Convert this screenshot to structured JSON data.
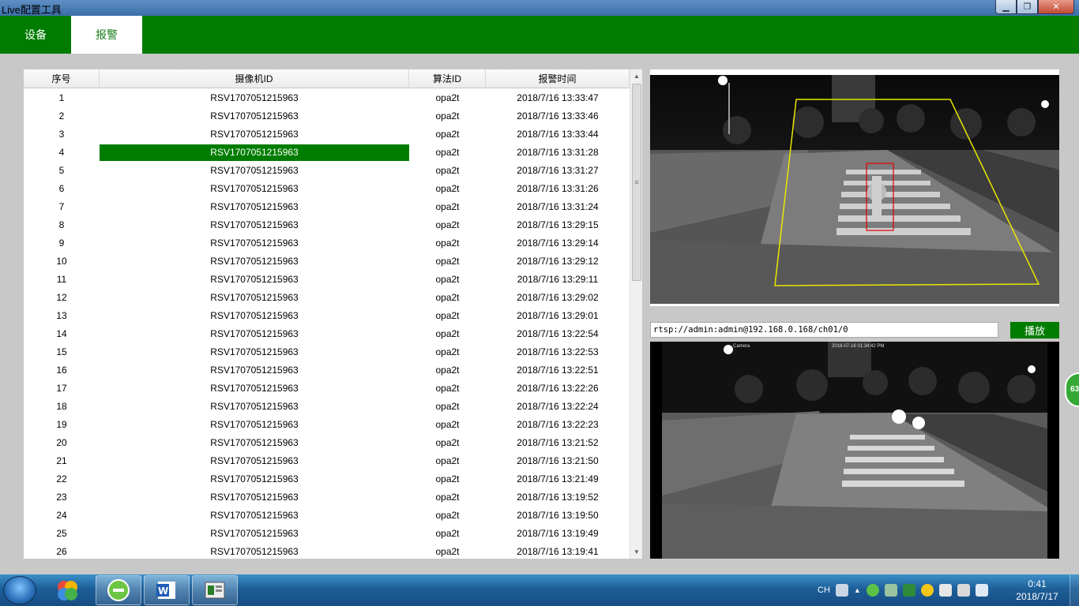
{
  "window": {
    "title": "Live配置工具"
  },
  "menu": {
    "tabs": [
      {
        "label": "设备"
      },
      {
        "label": "报警"
      }
    ],
    "active_tab": "报警",
    "accent": "#007d00"
  },
  "alarms": {
    "columns": [
      "序号",
      "摄像机ID",
      "算法ID",
      "报警时间"
    ],
    "selected_index": 4,
    "rows": [
      [
        "1",
        "RSV1707051215963",
        "opa2t",
        "2018/7/16 13:33:47"
      ],
      [
        "2",
        "RSV1707051215963",
        "opa2t",
        "2018/7/16 13:33:46"
      ],
      [
        "3",
        "RSV1707051215963",
        "opa2t",
        "2018/7/16 13:33:44"
      ],
      [
        "4",
        "RSV1707051215963",
        "opa2t",
        "2018/7/16 13:31:28"
      ],
      [
        "5",
        "RSV1707051215963",
        "opa2t",
        "2018/7/16 13:31:27"
      ],
      [
        "6",
        "RSV1707051215963",
        "opa2t",
        "2018/7/16 13:31:26"
      ],
      [
        "7",
        "RSV1707051215963",
        "opa2t",
        "2018/7/16 13:31:24"
      ],
      [
        "8",
        "RSV1707051215963",
        "opa2t",
        "2018/7/16 13:29:15"
      ],
      [
        "9",
        "RSV1707051215963",
        "opa2t",
        "2018/7/16 13:29:14"
      ],
      [
        "10",
        "RSV1707051215963",
        "opa2t",
        "2018/7/16 13:29:12"
      ],
      [
        "11",
        "RSV1707051215963",
        "opa2t",
        "2018/7/16 13:29:11"
      ],
      [
        "12",
        "RSV1707051215963",
        "opa2t",
        "2018/7/16 13:29:02"
      ],
      [
        "13",
        "RSV1707051215963",
        "opa2t",
        "2018/7/16 13:29:01"
      ],
      [
        "14",
        "RSV1707051215963",
        "opa2t",
        "2018/7/16 13:22:54"
      ],
      [
        "15",
        "RSV1707051215963",
        "opa2t",
        "2018/7/16 13:22:53"
      ],
      [
        "16",
        "RSV1707051215963",
        "opa2t",
        "2018/7/16 13:22:51"
      ],
      [
        "17",
        "RSV1707051215963",
        "opa2t",
        "2018/7/16 13:22:26"
      ],
      [
        "18",
        "RSV1707051215963",
        "opa2t",
        "2018/7/16 13:22:24"
      ],
      [
        "19",
        "RSV1707051215963",
        "opa2t",
        "2018/7/16 13:22:23"
      ],
      [
        "20",
        "RSV1707051215963",
        "opa2t",
        "2018/7/16 13:21:52"
      ],
      [
        "21",
        "RSV1707051215963",
        "opa2t",
        "2018/7/16 13:21:50"
      ],
      [
        "22",
        "RSV1707051215963",
        "opa2t",
        "2018/7/16 13:21:49"
      ],
      [
        "23",
        "RSV1707051215963",
        "opa2t",
        "2018/7/16 13:19:52"
      ],
      [
        "24",
        "RSV1707051215963",
        "opa2t",
        "2018/7/16 13:19:50"
      ],
      [
        "25",
        "RSV1707051215963",
        "opa2t",
        "2018/7/16 13:19:49"
      ],
      [
        "26",
        "RSV1707051215963",
        "opa2t",
        "2018/7/16 13:19:41"
      ]
    ]
  },
  "stream": {
    "url": "rtsp://admin:admin@192.168.0.168/ch01/0",
    "play_label": "播放",
    "overlay_camera": "Camera",
    "overlay_time": "2018-07-16 01:34:42 PM"
  },
  "side_badge": "63",
  "taskbar": {
    "lang": "CH",
    "time": "0:41",
    "date": "2018/7/17",
    "apps": [
      "windows-start",
      "app-launcher",
      "browser",
      "word",
      "live-config-tool"
    ]
  }
}
